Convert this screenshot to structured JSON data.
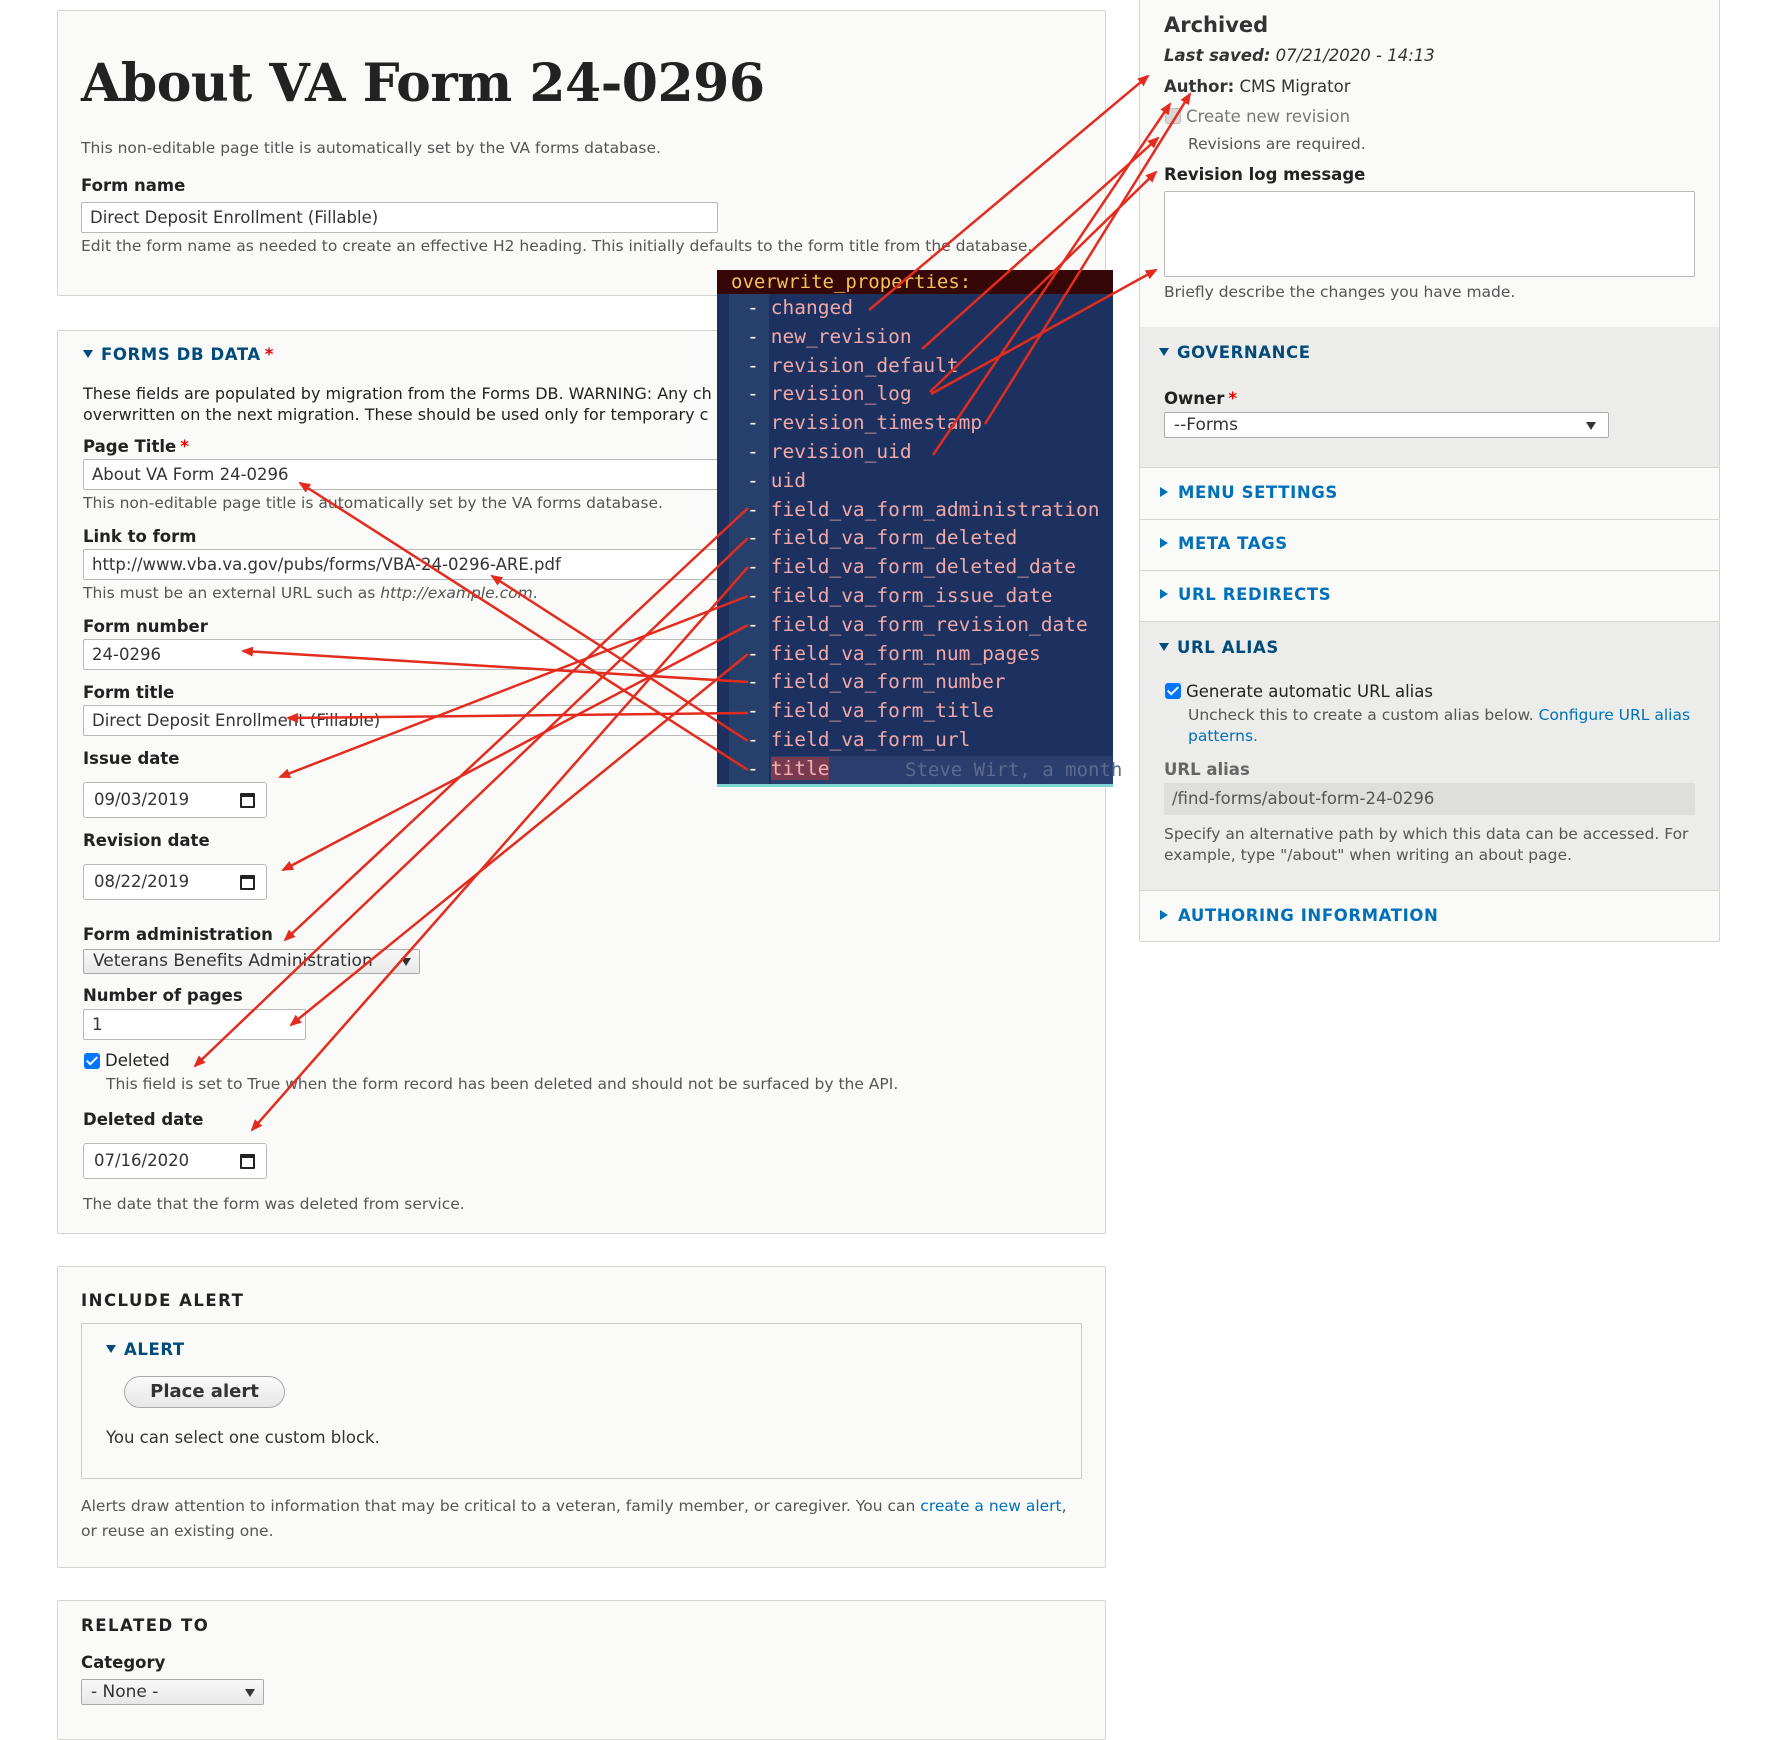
{
  "main": {
    "page_title": "About VA Form 24-0296",
    "page_title_desc": "This non-editable page title is automatically set by the VA forms database.",
    "form_name_label": "Form name",
    "form_name_value": "Direct Deposit Enrollment (Fillable)",
    "form_name_desc": "Edit the form name as needed to create an effective H2 heading. This initially defaults to the form title from the database."
  },
  "forms_db": {
    "section_title": "FORMS DB DATA",
    "desc_line1": "These fields are populated by migration from the Forms DB. WARNING: Any ch",
    "desc_line2": "overwritten on the next migration. These should be used only for temporary c",
    "page_title_label": "Page Title",
    "page_title_value": "About VA Form 24-0296",
    "page_title_desc": "This non-editable page title is automatically set by the VA forms database.",
    "link_label": "Link to form",
    "link_value": "http://www.vba.va.gov/pubs/forms/VBA-24-0296-ARE.pdf",
    "link_desc_prefix": "This must be an external URL such as ",
    "link_desc_example": "http://example.com",
    "link_desc_suffix": ".",
    "form_number_label": "Form number",
    "form_number_value": "24-0296",
    "form_title_label": "Form title",
    "form_title_value": "Direct Deposit Enrollment (Fillable)",
    "issue_date_label": "Issue date",
    "issue_date_value": "09/03/2019",
    "revision_date_label": "Revision date",
    "revision_date_value": "08/22/2019",
    "form_admin_label": "Form administration",
    "form_admin_value": "Veterans Benefits Administration",
    "num_pages_label": "Number of pages",
    "num_pages_value": "1",
    "deleted_label": "Deleted",
    "deleted_desc": "This field is set to True when the form record has been deleted and should not be surfaced by the API.",
    "deleted_date_label": "Deleted date",
    "deleted_date_value": "07/16/2020",
    "deleted_date_desc": "The date that the form was deleted from service."
  },
  "alert": {
    "section_title": "INCLUDE ALERT",
    "sub_title": "ALERT",
    "button": "Place alert",
    "note": "You can select one custom block.",
    "desc_prefix": "Alerts draw attention to information that may be critical to a veteran, family member, or caregiver. You can ",
    "desc_link": "create a new alert",
    "desc_suffix": ",",
    "desc_line2": "or reuse an existing one."
  },
  "related": {
    "section_title": "RELATED TO",
    "category_label": "Category",
    "category_value": "- None -"
  },
  "sidebar": {
    "status": "Archived",
    "last_saved_label": "Last saved:",
    "last_saved_value": "07/21/2020 - 14:13",
    "author_label": "Author:",
    "author_value": "CMS Migrator",
    "create_revision": "Create new revision",
    "revisions_required": "Revisions are required.",
    "revision_log_label": "Revision log message",
    "revision_log_desc": "Briefly describe the changes you have made.",
    "governance_title": "GOVERNANCE",
    "owner_label": "Owner",
    "owner_value": "--Forms",
    "menu_settings": "MENU SETTINGS",
    "meta_tags": "META TAGS",
    "url_redirects": "URL REDIRECTS",
    "url_alias_title": "URL ALIAS",
    "generate_alias": "Generate automatic URL alias",
    "uncheck_text": "Uncheck this to create a custom alias below. ",
    "configure_link_1": "Configure URL alias",
    "configure_link_2": "patterns",
    "configure_suffix": ".",
    "url_alias_label": "URL alias",
    "url_alias_value": "/find-forms/about-form-24-0296",
    "url_alias_desc_1": "Specify an alternative path by which this data can be accessed. For",
    "url_alias_desc_2": "example, type \"/about\" when writing an about page.",
    "authoring_info": "AUTHORING INFORMATION"
  },
  "terminal": {
    "header": "overwrite_properties:",
    "items": [
      "changed",
      "new_revision",
      "revision_default",
      "revision_log",
      "revision_timestamp",
      "revision_uid",
      "uid",
      "field_va_form_administration",
      "field_va_form_deleted",
      "field_va_form_deleted_date",
      "field_va_form_issue_date",
      "field_va_form_revision_date",
      "field_va_form_num_pages",
      "field_va_form_number",
      "field_va_form_title",
      "field_va_form_url",
      "title"
    ],
    "blame": "Steve Wirt, a month"
  },
  "colors": {
    "arrow": "#e32b1e",
    "link": "#0071b8",
    "section": "#004b7a",
    "terminal_bg": "#1d3160"
  }
}
